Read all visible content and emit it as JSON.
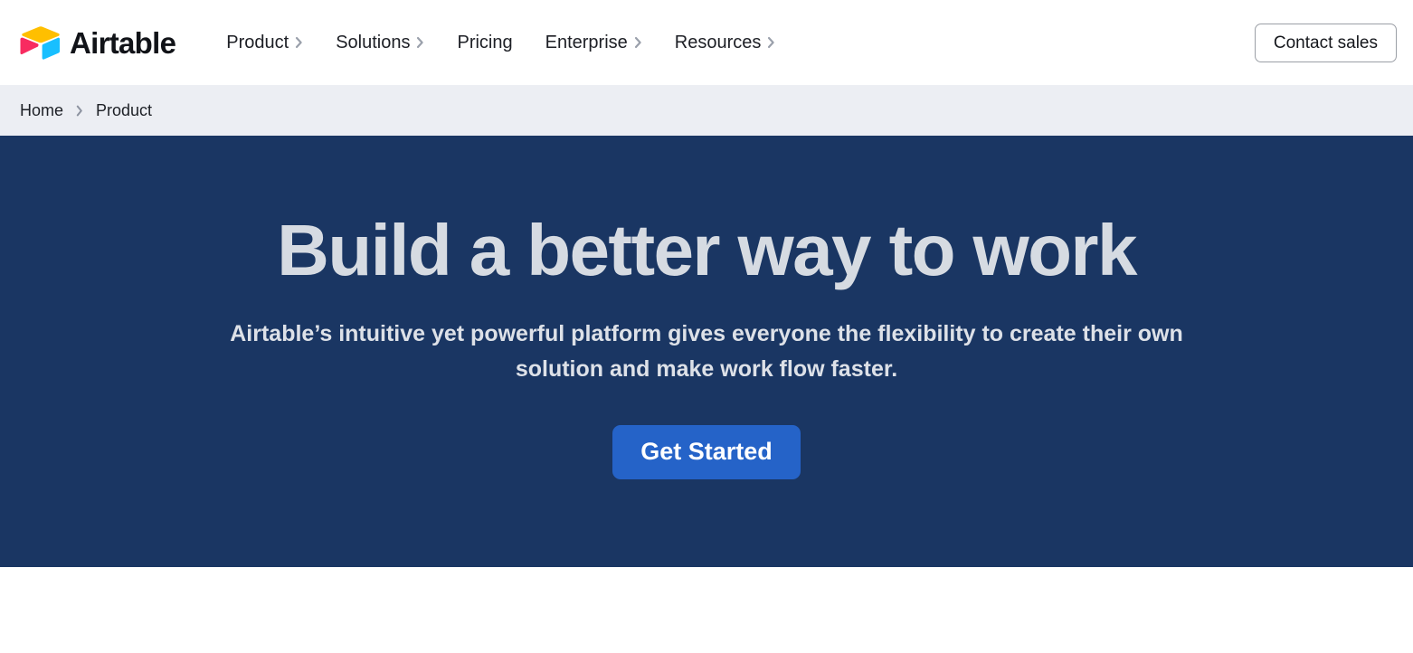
{
  "header": {
    "brand": {
      "name": "Airtable",
      "logo_icon": "airtable-logo-icon",
      "logo_colors": {
        "yellow": "#ffbf00",
        "pink": "#f82b60",
        "blue": "#18bfff",
        "dark": "#111318"
      }
    },
    "nav_items": [
      {
        "label": "Product",
        "has_chevron": true,
        "icon": "chevron-right-icon"
      },
      {
        "label": "Solutions",
        "has_chevron": true,
        "icon": "chevron-right-icon"
      },
      {
        "label": "Pricing",
        "has_chevron": false,
        "icon": ""
      },
      {
        "label": "Enterprise",
        "has_chevron": true,
        "icon": "chevron-right-icon"
      },
      {
        "label": "Resources",
        "has_chevron": true,
        "icon": "chevron-right-icon"
      }
    ],
    "contact_sales_label": "Contact sales"
  },
  "breadcrumb": {
    "separator_icon": "chevron-right-icon",
    "items": [
      {
        "label": "Home",
        "current": false
      },
      {
        "label": "Product",
        "current": true
      }
    ]
  },
  "hero": {
    "title": "Build a better way to work",
    "subtitle": "Airtable’s intuitive yet powerful platform gives everyone the flexibility to create their own solution and make work flow faster.",
    "cta_label": "Get Started",
    "background_color": "#1a3663",
    "cta_color": "#2563c8",
    "title_color": "#d6dbe2"
  }
}
